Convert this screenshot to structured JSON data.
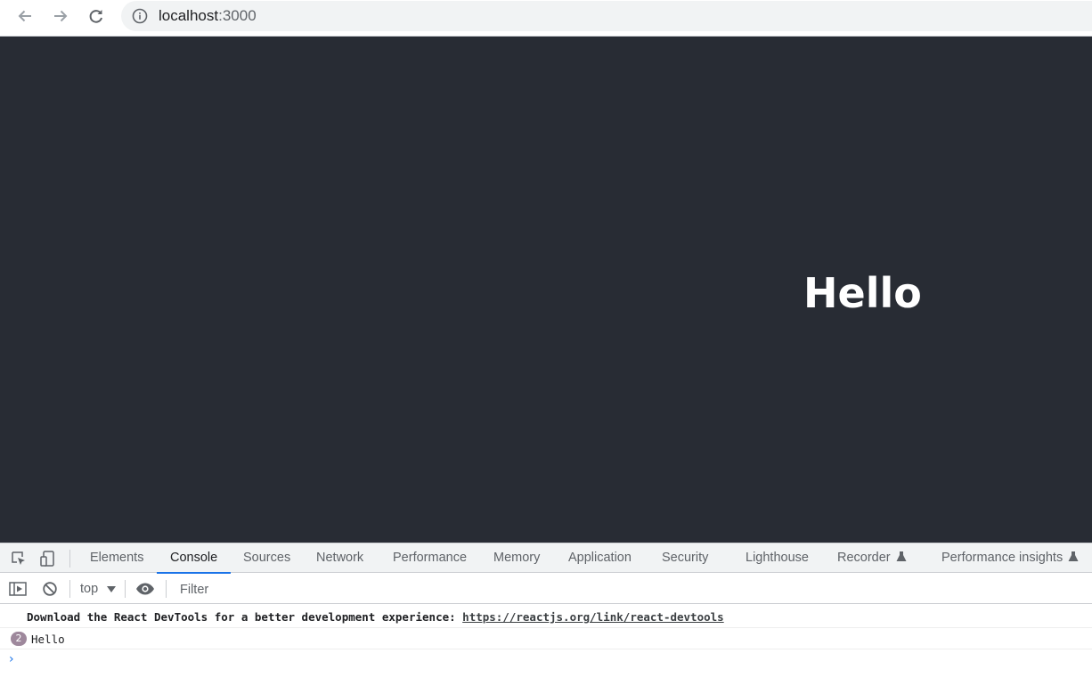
{
  "browser": {
    "url_host": "localhost",
    "url_port": ":3000"
  },
  "page": {
    "heading": "Hello",
    "background_color": "#282c34"
  },
  "devtools": {
    "tabs": [
      {
        "label": "Elements"
      },
      {
        "label": "Console",
        "active": true
      },
      {
        "label": "Sources"
      },
      {
        "label": "Network"
      },
      {
        "label": "Performance"
      },
      {
        "label": "Memory"
      },
      {
        "label": "Application"
      },
      {
        "label": "Security"
      },
      {
        "label": "Lighthouse"
      },
      {
        "label": "Recorder",
        "experimental": true
      },
      {
        "label": "Performance insights",
        "experimental": true
      }
    ],
    "console": {
      "context": "top",
      "filter_placeholder": "Filter",
      "messages": [
        {
          "text": "Download the React DevTools for a better development experience: ",
          "link": "https://reactjs.org/link/react-devtools"
        },
        {
          "repeat_count": "2",
          "text": "Hello"
        }
      ],
      "prompt_symbol": "›"
    },
    "accent_color": "#1a73e8"
  }
}
